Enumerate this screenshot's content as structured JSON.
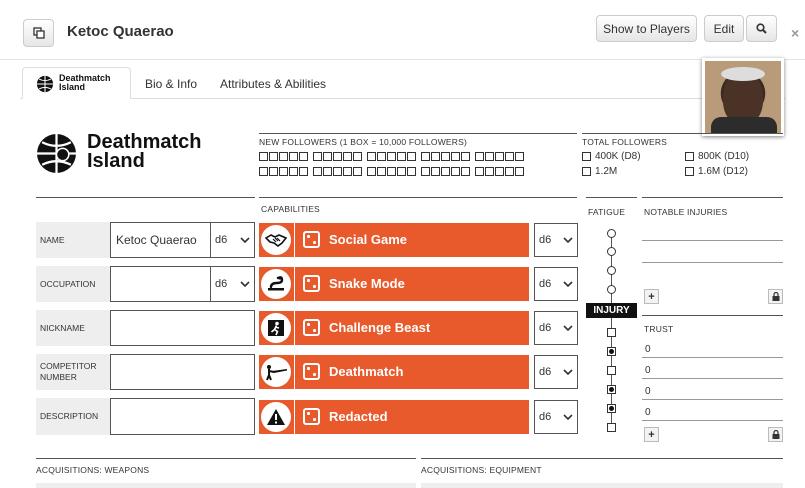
{
  "header": {
    "title": "Ketoc Quaerao",
    "show_players_label": "Show to Players",
    "edit_label": "Edit",
    "close_glyph": "×"
  },
  "tabs": [
    {
      "label": "Deathmatch Island",
      "icon": "deathmatch-logo-icon",
      "active": true
    },
    {
      "label": "Bio & Info",
      "active": false
    },
    {
      "label": "Attributes & Abilities",
      "active": false
    }
  ],
  "brand": {
    "line1": "Deathmatch",
    "line2": "Island",
    "tab_line1": "Deathmatch",
    "tab_line2": "Island"
  },
  "followers": {
    "label": "NEW FOLLOWERS  (1 BOX = 10,000 FOLLOWERS)",
    "total_label": "TOTAL FOLLOWERS",
    "totals": [
      "400K (D8)",
      "800K (D10)",
      "1.2M",
      "1.6M (D12)"
    ]
  },
  "fields": [
    {
      "label": "NAME",
      "value": "Ketoc Quaerao",
      "die": "d6"
    },
    {
      "label": "OCCUPATION",
      "value": "",
      "die": "d6"
    },
    {
      "label": "NICKNAME",
      "value": ""
    },
    {
      "label": "COMPETITOR NUMBER",
      "value": ""
    },
    {
      "label": "DESCRIPTION",
      "value": ""
    }
  ],
  "capabilities": {
    "label": "CAPABILITIES",
    "items": [
      {
        "name": "Social Game",
        "icon": "handshake-icon",
        "die": "d6"
      },
      {
        "name": "Snake Mode",
        "icon": "snake-icon",
        "die": "d6"
      },
      {
        "name": "Challenge Beast",
        "icon": "climber-icon",
        "die": "d6"
      },
      {
        "name": "Deathmatch",
        "icon": "rifle-icon",
        "die": "d6"
      },
      {
        "name": "Redacted",
        "icon": "warning-icon",
        "die": "d6"
      }
    ]
  },
  "fatigue": {
    "label": "FATIGUE",
    "injury_label": "INJURY",
    "injury_marks": [
      false,
      true,
      false,
      true,
      true,
      false
    ]
  },
  "notable_injuries": {
    "label": "NOTABLE INJURIES"
  },
  "trust": {
    "label": "TRUST",
    "values": [
      "0",
      "0",
      "0",
      "0"
    ]
  },
  "acquisitions": {
    "weapons_label": "ACQUISITIONS: WEAPONS",
    "equipment_label": "ACQUISITIONS: EQUIPMENT"
  },
  "colors": {
    "capability": "#e85a2b",
    "injury": "#111111"
  }
}
